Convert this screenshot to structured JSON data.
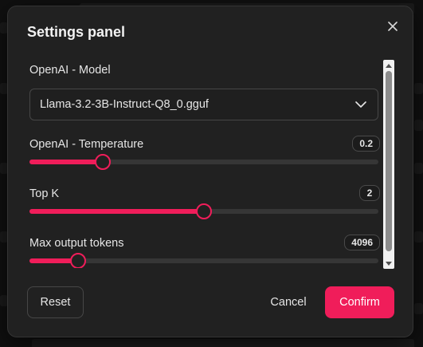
{
  "dialog": {
    "title": "Settings panel",
    "close_icon": "close-icon"
  },
  "fields": {
    "model": {
      "label": "OpenAI - Model",
      "value": "Llama-3.2-3B-Instruct-Q8_0.gguf",
      "icon": "chevron-down-icon"
    },
    "temperature": {
      "label": "OpenAI - Temperature",
      "value": "0.2",
      "level_percent": 21
    },
    "top_k": {
      "label": "Top K",
      "value": "2",
      "level_percent": 50
    },
    "max_tokens": {
      "label": "Max output tokens",
      "value": "4096",
      "level_percent": 14
    }
  },
  "footer": {
    "reset_label": "Reset",
    "cancel_label": "Cancel",
    "confirm_label": "Confirm"
  },
  "colors": {
    "accent": "#f01d5a",
    "panel_bg": "#212121",
    "track": "#363636"
  }
}
